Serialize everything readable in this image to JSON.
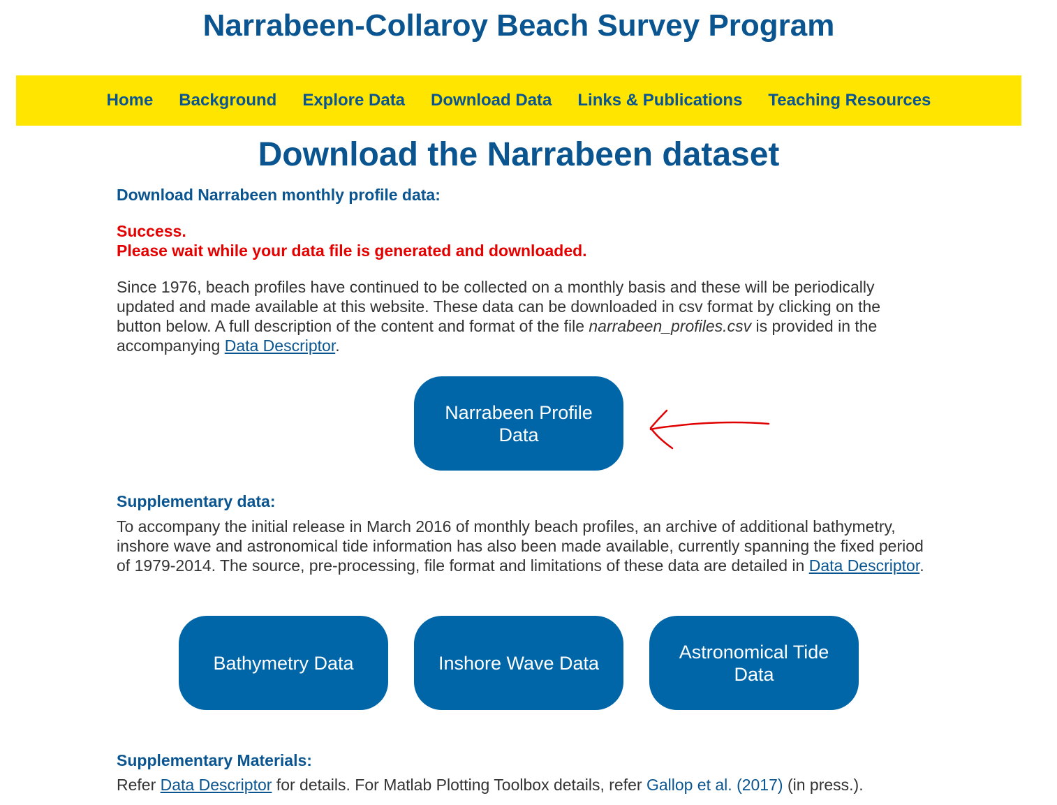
{
  "header": {
    "site_title": "Narrabeen-Collaroy Beach Survey Program"
  },
  "nav": {
    "items": [
      {
        "label": "Home"
      },
      {
        "label": "Background"
      },
      {
        "label": "Explore Data"
      },
      {
        "label": "Download Data"
      },
      {
        "label": "Links & Publications"
      },
      {
        "label": "Teaching Resources"
      }
    ]
  },
  "main": {
    "page_title": "Download the Narrabeen dataset",
    "profile_section": {
      "heading": "Download Narrabeen monthly profile data:",
      "status_line1": "Success.",
      "status_line2": "Please wait while your data file is generated and downloaded.",
      "description_part1": "Since 1976, beach profiles have continued to be collected on a monthly basis and these will be periodically updated and made available at this website. These data can be downloaded in csv format by clicking on the button below. A full description of the content and format of the file ",
      "filename": "narrabeen_profiles.csv",
      "description_part2": " is provided in the accompanying ",
      "link_text": "Data Descriptor",
      "description_end": ".",
      "button_label": "Narrabeen Profile Data"
    },
    "supplementary_section": {
      "heading": "Supplementary data:",
      "description_part1": "To accompany the initial release in March 2016 of monthly beach profiles, an archive of additional bathymetry, inshore wave and astronomical tide information has also been made available, currently spanning the fixed period of 1979-2014. The source, pre-processing, file format and limitations of these data are detailed in ",
      "link_text": "Data Descriptor",
      "description_end": ".",
      "buttons": [
        {
          "label": "Bathymetry Data"
        },
        {
          "label": "Inshore Wave Data"
        },
        {
          "label": "Astronomical Tide Data"
        }
      ]
    },
    "materials_section": {
      "heading": "Supplementary Materials:",
      "text_refer": "Refer ",
      "link1_text": "Data Descriptor",
      "text_middle": " for details. For Matlab Plotting Toolbox details, refer ",
      "link2_text": "Gallop et al. (2017)",
      "text_end": " (in press.)."
    }
  },
  "colors": {
    "brand_blue": "#0a5590",
    "button_blue": "#0066a8",
    "nav_yellow": "#ffe500",
    "status_red": "#e50000",
    "annotation_red": "#e00000"
  }
}
